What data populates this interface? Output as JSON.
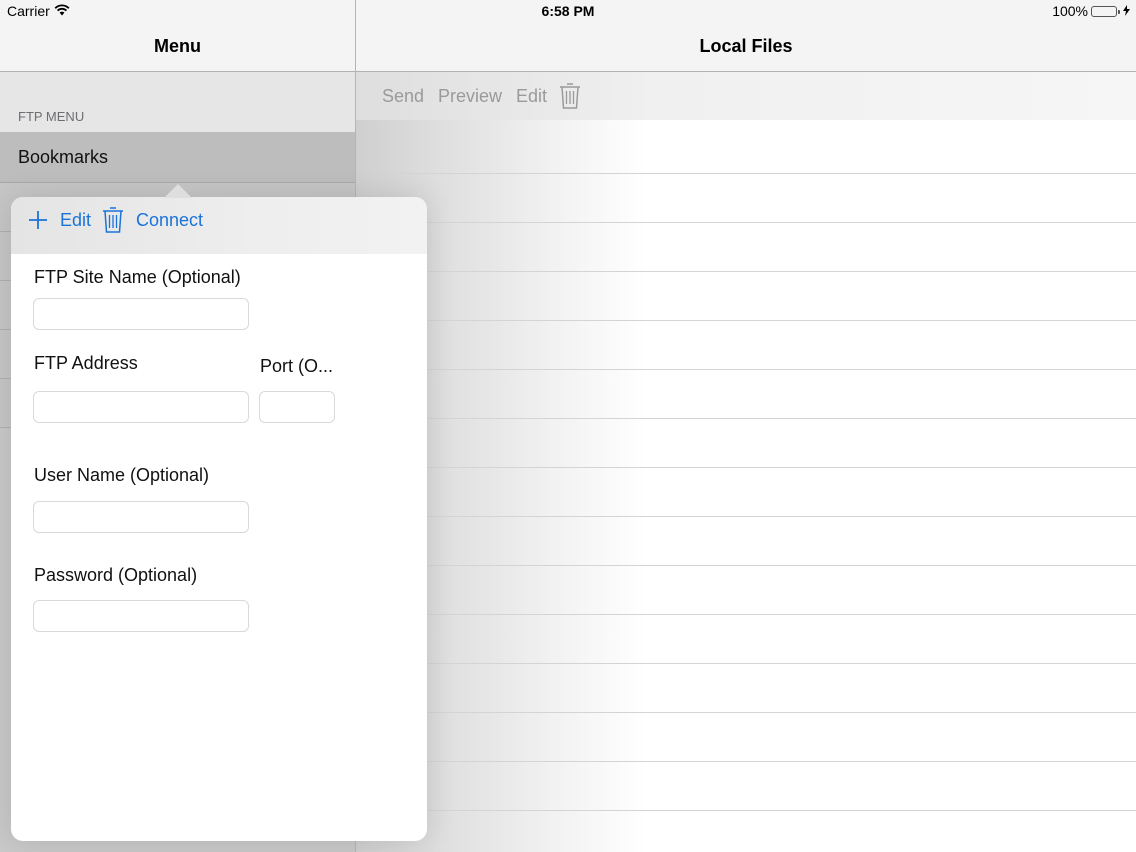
{
  "status_bar": {
    "carrier": "Carrier",
    "time": "6:58 PM",
    "battery": "100%"
  },
  "menu_pane": {
    "title": "Menu",
    "section_header": "FTP MENU",
    "selected_item": "Bookmarks"
  },
  "files_pane": {
    "title": "Local Files",
    "toolbar": {
      "send": "Send",
      "preview": "Preview",
      "edit": "Edit"
    }
  },
  "popover": {
    "toolbar": {
      "edit": "Edit",
      "connect": "Connect"
    },
    "fields": {
      "site_name_label": "FTP Site Name (Optional)",
      "site_name_value": "",
      "address_label": "FTP Address",
      "address_value": "",
      "port_label": "Port (O...",
      "port_value": "",
      "username_label": "User Name (Optional)",
      "username_value": "",
      "password_label": "Password (Optional)",
      "password_value": ""
    }
  },
  "colors": {
    "accent": "#1a73d9",
    "disabled_text": "#9a9a9a",
    "battery": "#4cd964"
  },
  "icons": {
    "wifi": "wifi-icon",
    "battery": "battery-icon",
    "charging": "charging-bolt-icon",
    "trash": "trash-icon",
    "add": "plus-icon"
  }
}
